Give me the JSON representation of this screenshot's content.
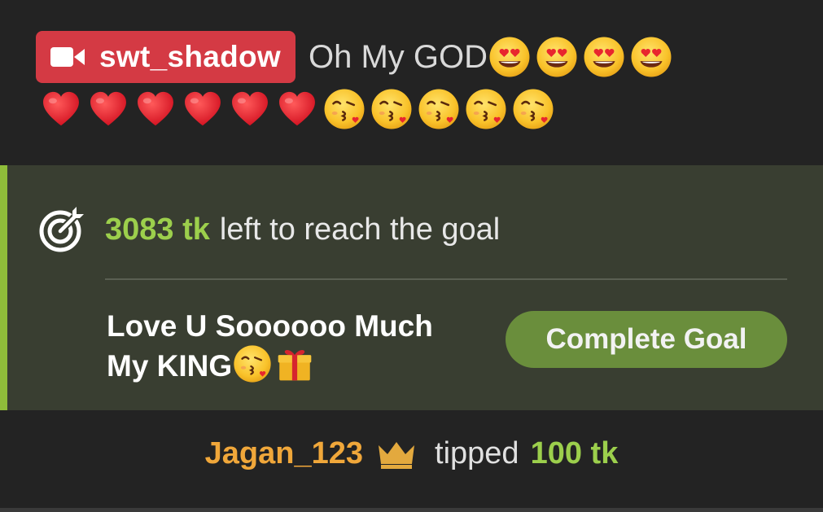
{
  "message": {
    "username": "swt_shadow",
    "user_icon": "video-camera-icon",
    "text": "Oh My GOD",
    "line1_emojis": [
      "heart-eyes-emoji",
      "heart-eyes-emoji",
      "heart-eyes-emoji",
      "heart-eyes-emoji"
    ],
    "line2_emojis": [
      "red-heart-emoji",
      "red-heart-emoji",
      "red-heart-emoji",
      "red-heart-emoji",
      "red-heart-emoji",
      "red-heart-emoji",
      "kissing-heart-emoji",
      "kissing-heart-emoji",
      "kissing-heart-emoji",
      "kissing-heart-emoji",
      "kissing-heart-emoji"
    ]
  },
  "goal": {
    "icon": "target-icon",
    "amount": "3083 tk",
    "rest_text": "left to reach the goal",
    "description_line1": "Love U Soooooo Much",
    "description_line2": "My KING",
    "description_emojis": [
      "kissing-heart-emoji",
      "gift-emoji"
    ],
    "button_label": "Complete Goal"
  },
  "tip": {
    "username": "Jagan_123",
    "badge_icon": "crown-icon",
    "verb": "tipped",
    "amount": "100 tk"
  },
  "colors": {
    "background": "#232323",
    "badge_red": "#d43a44",
    "goal_panel": "#393e31",
    "accent_green": "#9ccf4c",
    "button_green": "#6a8e3c",
    "username_orange": "#f0a73a"
  }
}
